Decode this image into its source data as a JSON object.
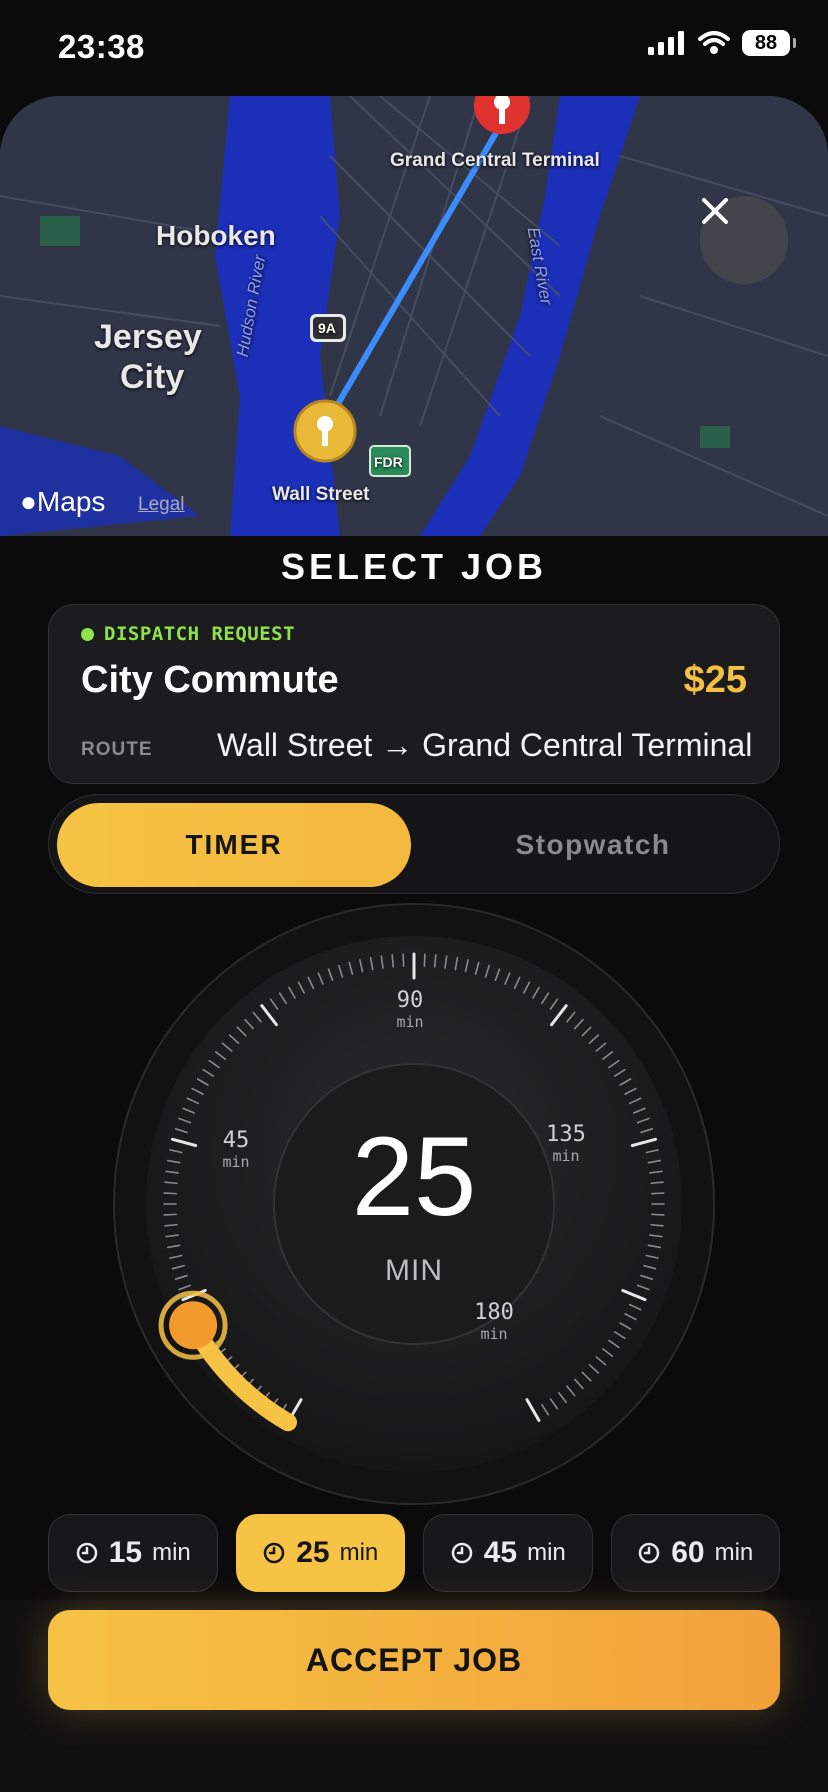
{
  "status_bar": {
    "time": "23:38",
    "battery": "88"
  },
  "map": {
    "labels": {
      "grand_central": "Grand Central Terminal",
      "hoboken": "Hoboken",
      "jersey_city_1": "Jersey",
      "jersey_city_2": "City",
      "hudson_river": "Hudson River",
      "east_river": "East River",
      "wall_street": "Wall Street",
      "route_9a": "9A",
      "fdr": "FDR"
    },
    "attribution": {
      "maps": "Maps",
      "legal": "Legal"
    }
  },
  "sheet": {
    "title": "SELECT JOB"
  },
  "job": {
    "badge": "DISPATCH REQUEST",
    "title": "City Commute",
    "price": "$25",
    "route_label": "ROUTE",
    "route": "Wall Street → Grand Central Terminal"
  },
  "mode": {
    "timer": "TIMER",
    "stopwatch": "Stopwatch",
    "selected": "timer"
  },
  "dial": {
    "value": "25",
    "unit": "MIN",
    "marks": [
      {
        "value": "45",
        "unit": "min"
      },
      {
        "value": "90",
        "unit": "min"
      },
      {
        "value": "135",
        "unit": "min"
      },
      {
        "value": "180",
        "unit": "min"
      }
    ],
    "accent": "#f6c344",
    "knob_color": "#f29a2e"
  },
  "presets": [
    {
      "value": "15",
      "unit": "min",
      "active": false
    },
    {
      "value": "25",
      "unit": "min",
      "active": true
    },
    {
      "value": "45",
      "unit": "min",
      "active": false
    },
    {
      "value": "60",
      "unit": "min",
      "active": false
    }
  ],
  "actions": {
    "accept": "ACCEPT JOB"
  },
  "colors": {
    "accent": "#f6c344",
    "dispatch_green": "#8fe34a",
    "route_blue": "#3b8cff"
  }
}
